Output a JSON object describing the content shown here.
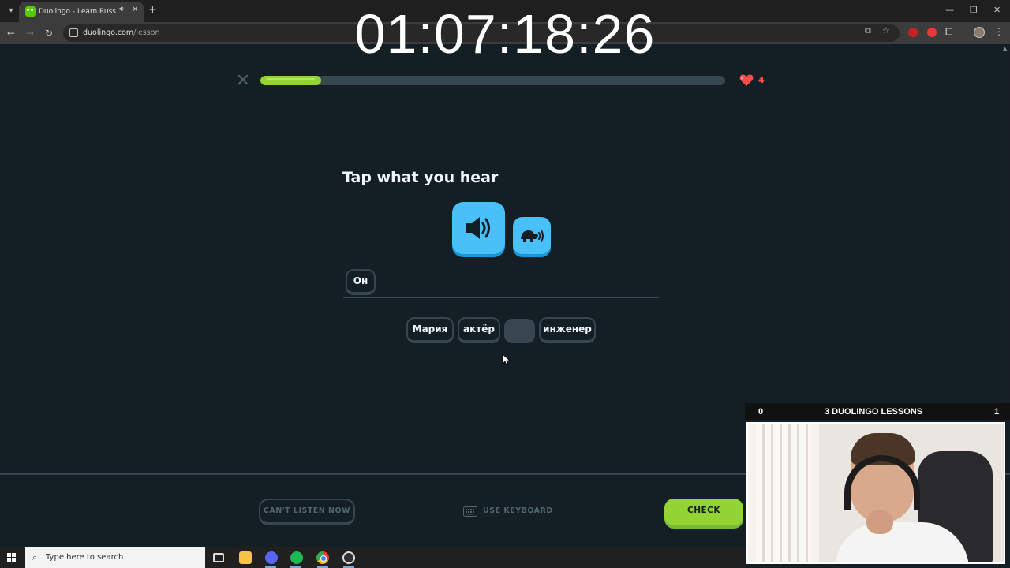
{
  "browser": {
    "tab_title": "Duolingo - Learn Russian w",
    "url_host": "duolingo.com",
    "url_path": "/lesson"
  },
  "stream": {
    "timer": "01:07:18:26",
    "left_score": "0",
    "goal_label": "3 DUOLINGO LESSONS",
    "right_score": "1"
  },
  "lesson": {
    "progress_fraction": 0.13,
    "hearts": "4",
    "prompt": "Tap what you hear",
    "answer_words": [
      "Он"
    ],
    "word_bank": [
      "Мария",
      "актёр",
      "",
      "инженер"
    ]
  },
  "footer": {
    "cant_listen_label": "CAN'T LISTEN NOW",
    "keyboard_label": "USE KEYBOARD",
    "check_label": "CHECK"
  },
  "taskbar": {
    "search_placeholder": "Type here to search"
  },
  "colors": {
    "background": "#131f24",
    "progress_green": "#93d333",
    "speaker_blue": "#49c0f8",
    "heart_red": "#ff4b4b",
    "border_gray": "#37464f"
  },
  "icons": [
    "speaker-icon",
    "turtle-icon",
    "heart-icon",
    "keyboard-icon",
    "close-icon"
  ]
}
